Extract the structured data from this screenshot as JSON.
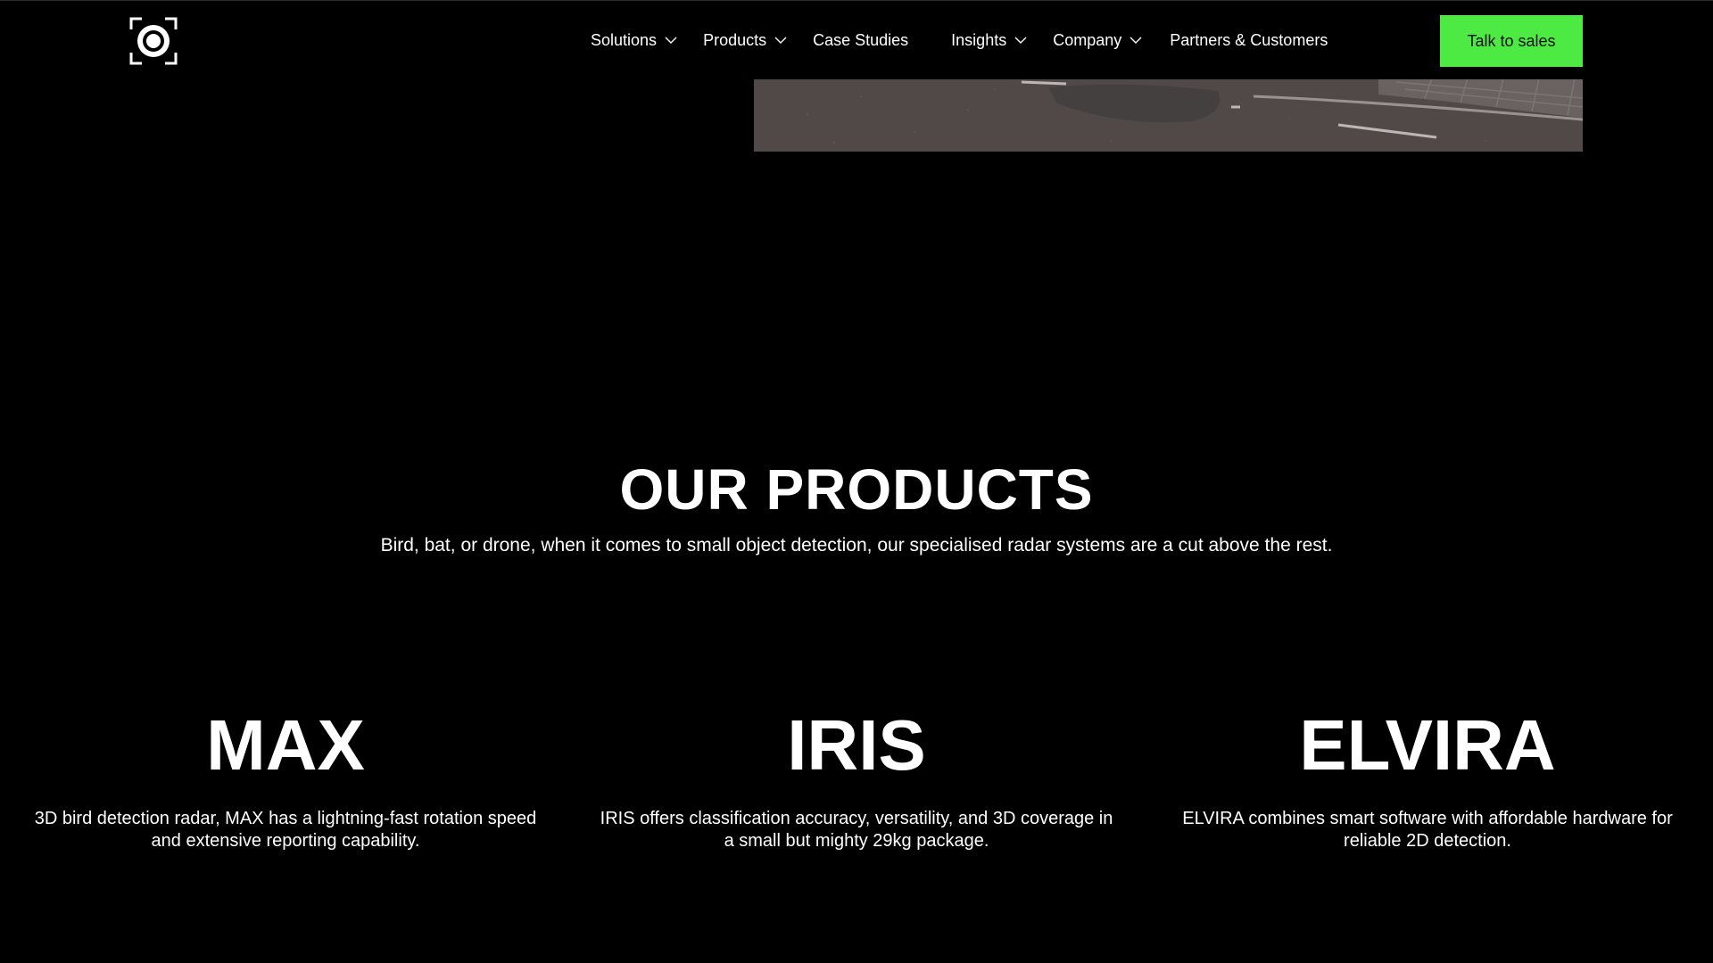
{
  "header": {
    "logo_icon": "camera-target-icon",
    "nav": {
      "solutions": "Solutions",
      "products": "Products",
      "case_studies": "Case Studies",
      "insights": "Insights",
      "company": "Company",
      "partners": "Partners & Customers"
    },
    "cta_label": "Talk to sales"
  },
  "colors": {
    "background": "#000000",
    "accent": "#4eea44",
    "text": "#ffffff"
  },
  "products_section": {
    "title": "OUR PRODUCTS",
    "subtitle": "Bird, bat, or drone, when it comes to small object detection, our specialised radar systems are a cut above the rest.",
    "items": [
      {
        "name": "MAX",
        "description": "3D bird detection radar, MAX has a lightning-fast rotation speed and extensive reporting capability."
      },
      {
        "name": "IRIS",
        "description": "IRIS offers classification accuracy, versatility, and 3D coverage in a small but mighty 29kg package."
      },
      {
        "name": "ELVIRA",
        "description": "ELVIRA combines smart software with affordable hardware for reliable 2D detection."
      }
    ]
  }
}
